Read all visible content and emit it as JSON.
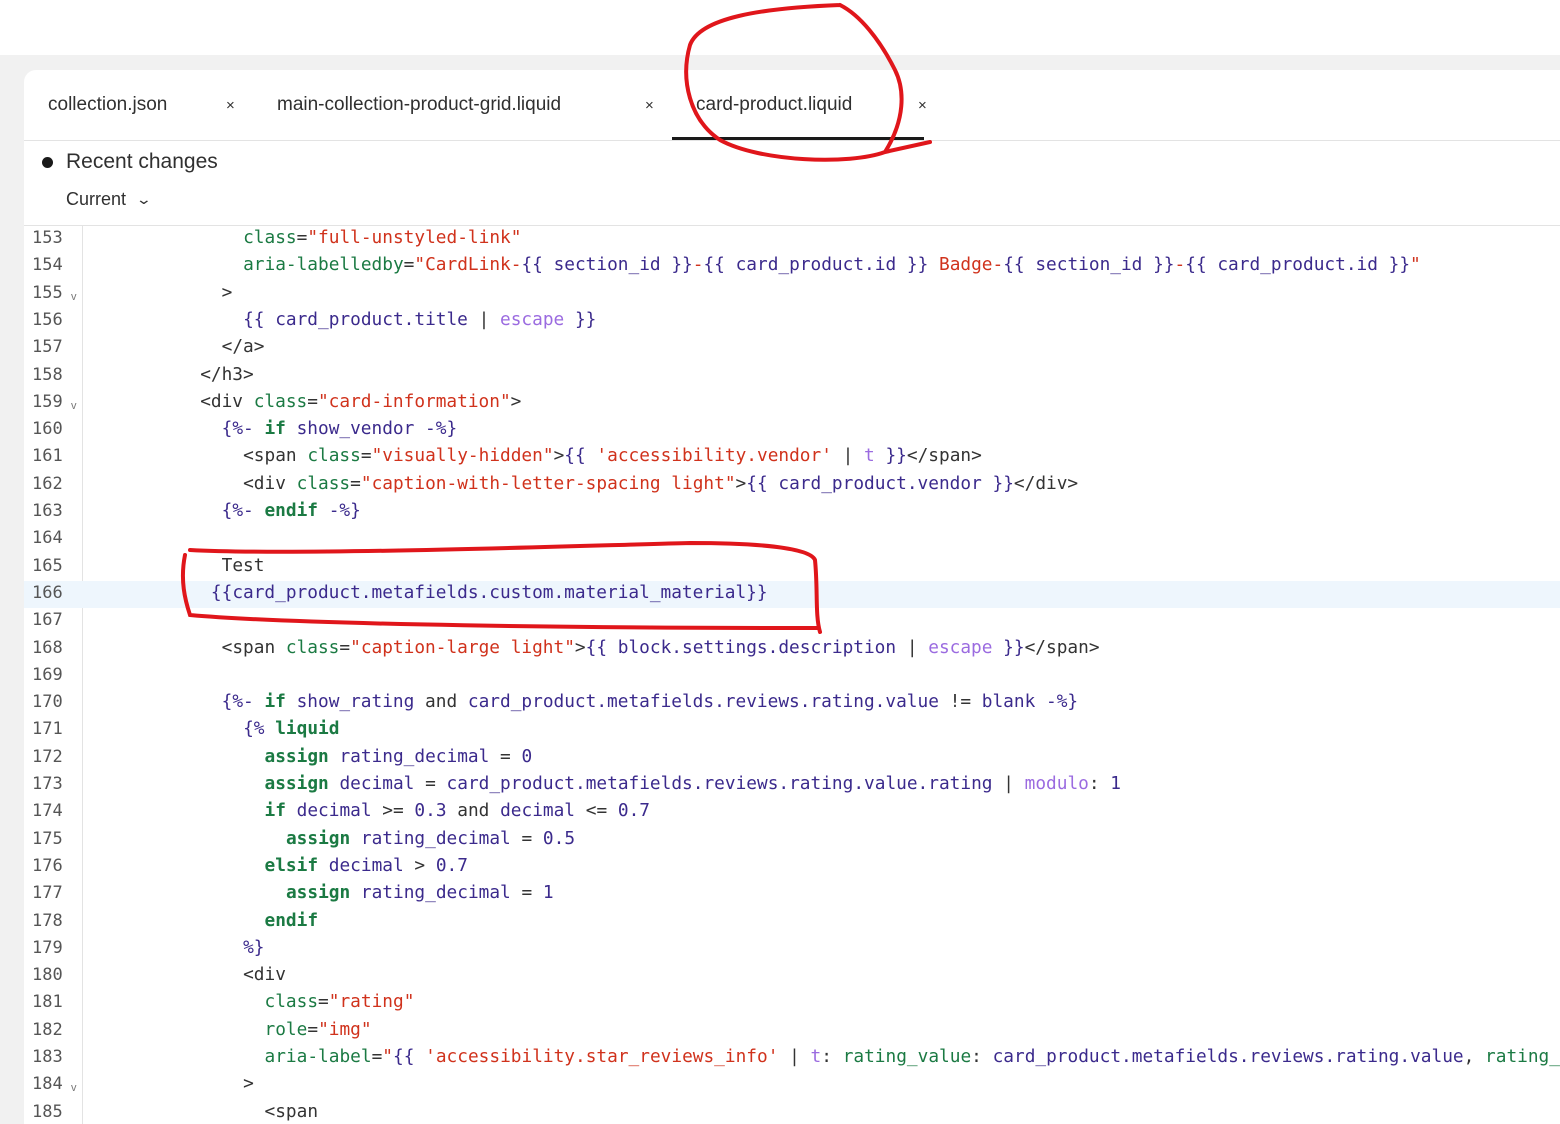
{
  "tabs": [
    {
      "label": "collection.json",
      "close": "×"
    },
    {
      "label": "main-collection-product-grid.liquid",
      "close": "×"
    },
    {
      "label": "card-product.liquid",
      "close": "×",
      "active": true
    }
  ],
  "recent_changes": {
    "title": "Recent changes",
    "version": "Current",
    "chevron": "⌄"
  },
  "fold_marker": "v",
  "highlighted_line": 166,
  "colors": {
    "string": "#d0321c",
    "attribute": "#1b7a43",
    "variable": "#3b2a8c",
    "filter": "#9b6be0",
    "annotation": "#e0161b"
  },
  "lines": [
    {
      "n": "153",
      "indent": 14,
      "tokens": [
        [
          "a",
          "class"
        ],
        [
          "p",
          "="
        ],
        [
          "s",
          "\"full-unstyled-link\""
        ]
      ]
    },
    {
      "n": "154",
      "indent": 14,
      "tokens": [
        [
          "a",
          "aria-labelledby"
        ],
        [
          "p",
          "="
        ],
        [
          "s",
          "\"CardLink-"
        ],
        [
          "v",
          "{{ section_id }}"
        ],
        [
          "s",
          "-"
        ],
        [
          "v",
          "{{ card_product.id }}"
        ],
        [
          "s",
          " Badge-"
        ],
        [
          "v",
          "{{ section_id }}"
        ],
        [
          "s",
          "-"
        ],
        [
          "v",
          "{{ card_product.id }}"
        ],
        [
          "s",
          "\""
        ]
      ]
    },
    {
      "n": "155",
      "indent": 12,
      "fold": true,
      "tokens": [
        [
          "p",
          ">"
        ]
      ]
    },
    {
      "n": "156",
      "indent": 14,
      "tokens": [
        [
          "v",
          "{{ card_product.title "
        ],
        [
          "p",
          "| "
        ],
        [
          "f",
          "escape"
        ],
        [
          "v",
          " }}"
        ]
      ]
    },
    {
      "n": "157",
      "indent": 12,
      "tokens": [
        [
          "p",
          "</a>"
        ]
      ]
    },
    {
      "n": "158",
      "indent": 10,
      "tokens": [
        [
          "p",
          "</h3>"
        ]
      ]
    },
    {
      "n": "159",
      "indent": 10,
      "fold": true,
      "tokens": [
        [
          "p",
          "<div "
        ],
        [
          "a",
          "class"
        ],
        [
          "p",
          "="
        ],
        [
          "s",
          "\"card-information\""
        ],
        [
          "p",
          ">"
        ]
      ]
    },
    {
      "n": "160",
      "indent": 12,
      "tokens": [
        [
          "v",
          "{%- "
        ],
        [
          "k",
          "if"
        ],
        [
          "v",
          " show_vendor -%}"
        ]
      ]
    },
    {
      "n": "161",
      "indent": 14,
      "tokens": [
        [
          "p",
          "<span "
        ],
        [
          "a",
          "class"
        ],
        [
          "p",
          "="
        ],
        [
          "s",
          "\"visually-hidden\""
        ],
        [
          "p",
          ">"
        ],
        [
          "v",
          "{{ "
        ],
        [
          "s",
          "'accessibility.vendor'"
        ],
        [
          "p",
          " | "
        ],
        [
          "f",
          "t"
        ],
        [
          "v",
          " }}"
        ],
        [
          "p",
          "</span>"
        ]
      ]
    },
    {
      "n": "162",
      "indent": 14,
      "tokens": [
        [
          "p",
          "<div "
        ],
        [
          "a",
          "class"
        ],
        [
          "p",
          "="
        ],
        [
          "s",
          "\"caption-with-letter-spacing light\""
        ],
        [
          "p",
          ">"
        ],
        [
          "v",
          "{{ card_product.vendor }}"
        ],
        [
          "p",
          "</div>"
        ]
      ]
    },
    {
      "n": "163",
      "indent": 12,
      "tokens": [
        [
          "v",
          "{%- "
        ],
        [
          "k",
          "endif"
        ],
        [
          "v",
          " -%}"
        ]
      ]
    },
    {
      "n": "164",
      "indent": 0,
      "tokens": []
    },
    {
      "n": "165",
      "indent": 12,
      "tokens": [
        [
          "p",
          "Test"
        ]
      ]
    },
    {
      "n": "166",
      "indent": 11,
      "tokens": [
        [
          "v",
          "{{card_product.metafields.custom.material_material}}"
        ]
      ]
    },
    {
      "n": "167",
      "indent": 0,
      "tokens": []
    },
    {
      "n": "168",
      "indent": 12,
      "tokens": [
        [
          "p",
          "<span "
        ],
        [
          "a",
          "class"
        ],
        [
          "p",
          "="
        ],
        [
          "s",
          "\"caption-large light\""
        ],
        [
          "p",
          ">"
        ],
        [
          "v",
          "{{ block.settings.description "
        ],
        [
          "p",
          "| "
        ],
        [
          "f",
          "escape"
        ],
        [
          "v",
          " }}"
        ],
        [
          "p",
          "</span>"
        ]
      ]
    },
    {
      "n": "169",
      "indent": 0,
      "tokens": []
    },
    {
      "n": "170",
      "indent": 12,
      "tokens": [
        [
          "v",
          "{%- "
        ],
        [
          "k",
          "if"
        ],
        [
          "v",
          " show_rating "
        ],
        [
          "p",
          "and"
        ],
        [
          "v",
          " card_product.metafields.reviews.rating.value "
        ],
        [
          "p",
          "!="
        ],
        [
          "v",
          " blank -%}"
        ]
      ]
    },
    {
      "n": "171",
      "indent": 14,
      "tokens": [
        [
          "v",
          "{% "
        ],
        [
          "k",
          "liquid"
        ]
      ]
    },
    {
      "n": "172",
      "indent": 16,
      "tokens": [
        [
          "k",
          "assign"
        ],
        [
          "v",
          " rating_decimal "
        ],
        [
          "p",
          "= "
        ],
        [
          "n",
          "0"
        ]
      ]
    },
    {
      "n": "173",
      "indent": 16,
      "tokens": [
        [
          "k",
          "assign"
        ],
        [
          "v",
          " decimal "
        ],
        [
          "p",
          "= "
        ],
        [
          "v",
          "card_product.metafields.reviews.rating.value.rating "
        ],
        [
          "p",
          "| "
        ],
        [
          "f",
          "modulo"
        ],
        [
          "p",
          ": "
        ],
        [
          "n",
          "1"
        ]
      ]
    },
    {
      "n": "174",
      "indent": 16,
      "tokens": [
        [
          "k",
          "if"
        ],
        [
          "v",
          " decimal "
        ],
        [
          "p",
          ">= "
        ],
        [
          "n",
          "0.3"
        ],
        [
          "p",
          " and "
        ],
        [
          "v",
          "decimal "
        ],
        [
          "p",
          "<= "
        ],
        [
          "n",
          "0.7"
        ]
      ]
    },
    {
      "n": "175",
      "indent": 18,
      "tokens": [
        [
          "k",
          "assign"
        ],
        [
          "v",
          " rating_decimal "
        ],
        [
          "p",
          "= "
        ],
        [
          "n",
          "0.5"
        ]
      ]
    },
    {
      "n": "176",
      "indent": 16,
      "tokens": [
        [
          "k",
          "elsif"
        ],
        [
          "v",
          " decimal "
        ],
        [
          "p",
          "> "
        ],
        [
          "n",
          "0.7"
        ]
      ]
    },
    {
      "n": "177",
      "indent": 18,
      "tokens": [
        [
          "k",
          "assign"
        ],
        [
          "v",
          " rating_decimal "
        ],
        [
          "p",
          "= "
        ],
        [
          "n",
          "1"
        ]
      ]
    },
    {
      "n": "178",
      "indent": 16,
      "tokens": [
        [
          "k",
          "endif"
        ]
      ]
    },
    {
      "n": "179",
      "indent": 14,
      "tokens": [
        [
          "v",
          "%}"
        ]
      ]
    },
    {
      "n": "180",
      "indent": 14,
      "tokens": [
        [
          "p",
          "<div"
        ]
      ]
    },
    {
      "n": "181",
      "indent": 16,
      "tokens": [
        [
          "a",
          "class"
        ],
        [
          "p",
          "="
        ],
        [
          "s",
          "\"rating\""
        ]
      ]
    },
    {
      "n": "182",
      "indent": 16,
      "tokens": [
        [
          "a",
          "role"
        ],
        [
          "p",
          "="
        ],
        [
          "s",
          "\"img\""
        ]
      ]
    },
    {
      "n": "183",
      "indent": 16,
      "tokens": [
        [
          "a",
          "aria-label"
        ],
        [
          "p",
          "="
        ],
        [
          "s",
          "\""
        ],
        [
          "v",
          "{{ "
        ],
        [
          "s",
          "'accessibility.star_reviews_info'"
        ],
        [
          "p",
          " | "
        ],
        [
          "f",
          "t"
        ],
        [
          "p",
          ": "
        ],
        [
          "a",
          "rating_value"
        ],
        [
          "p",
          ": "
        ],
        [
          "v",
          "card_product.metafields.reviews.rating.value"
        ],
        [
          "p",
          ", "
        ],
        [
          "a",
          "rating_"
        ]
      ]
    },
    {
      "n": "184",
      "indent": 14,
      "fold": true,
      "tokens": [
        [
          "p",
          ">"
        ]
      ]
    },
    {
      "n": "185",
      "indent": 16,
      "tokens": [
        [
          "p",
          "<span"
        ]
      ]
    }
  ]
}
